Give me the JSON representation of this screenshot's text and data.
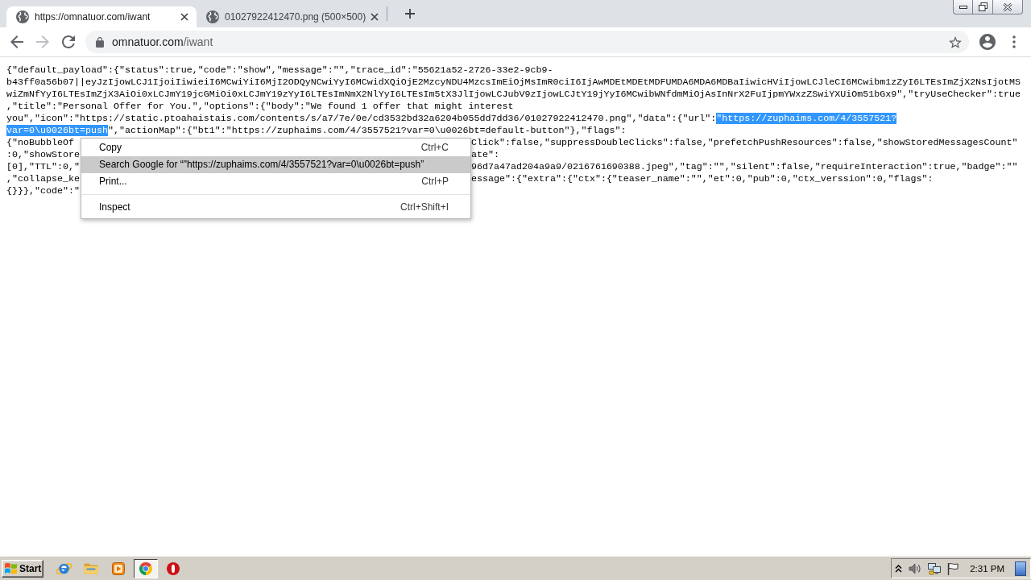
{
  "tabs": [
    {
      "title": "https://omnatuor.com/iwant",
      "selected": true
    },
    {
      "title": "01027922412470.png (500×500)",
      "selected": false
    }
  ],
  "toolbar": {
    "nav_buttons": [
      {
        "kind": "back",
        "disabled": false
      },
      {
        "kind": "forward",
        "disabled": true
      },
      {
        "kind": "reload",
        "disabled": false
      }
    ],
    "address": {
      "host": "omnatuor.com",
      "path": "/iwant"
    }
  },
  "page": {
    "lines": [
      {
        "kind": "text",
        "segments": [
          {
            "text": "{\"default_payload\":{\"status\":true,\"code\":\"show\",\"message\":\"\",\"trace_id\":\"55621a52-2726-33e2-9cb9-",
            "selected": false
          }
        ]
      },
      {
        "kind": "text",
        "segments": [
          {
            "text": "b43ff0a56b07||eyJzIjowLCJ1IjoiIiwieiI6MCwiYiI6MjI2ODQyNCwiYyI6MCwidXQiOjE2MzcyNDU4MzcsImEiOjMsImR0ciI6IjAwMDEtMDEtMDFUMDA6MDA6MDBaIiwicHViIjowLCJleCI6MCwibm1zZyI6LTEsImZjX2NsIjotMS",
            "selected": false
          }
        ]
      },
      {
        "kind": "text",
        "segments": [
          {
            "text": "wiZmNfYyI6LTEsImZjX3AiOi0xLCJmY19jcGMiOi0xLCJmY19zYyI6LTEsImNmX2NlYyI6LTEsIm5tX3JlIjowLCJubV9zIjowLCJtY19jYyI6MCwibWNfdmMiOjAsInNrX2FuIjpmYWxzZSwiYXUiOm51bGx9\",\"tryUseChecker\":true",
            "selected": false
          }
        ]
      },
      {
        "kind": "text",
        "segments": [
          {
            "text": ",\"title\":\"Personal Offer for You.\",\"options\":{\"body\":\"We found 1 offer that might interest",
            "selected": false
          }
        ]
      },
      {
        "kind": "text",
        "segments": [
          {
            "text": "you\",\"icon\":\"https://static.ptoahaistais.com/contents/s/a7/7e/0e/cd3532bd32a6204b055dd7dd36/01027922412470.png\",\"data\":{\"url\":",
            "selected": false
          },
          {
            "text": "\"https://zuphaims.com/4/3557521?",
            "selected": true
          }
        ]
      },
      {
        "kind": "text",
        "segments": [
          {
            "text": "var=0\\u0026bt=push",
            "selected": true
          },
          {
            "text": "\",\"actionMap\":{\"bt1\":\"https://zuphaims.com/4/3557521?var=0\\u0026bt=default-button\"},\"flags\":",
            "selected": false
          }
        ]
      },
      {
        "kind": "split",
        "left": "{\"noBubbleOf",
        "right": "Click\":false,\"suppressDoubleClicks\":false,\"prefetchPushResources\":false,\"showStoredMessagesCount\""
      },
      {
        "kind": "split",
        "left": ":0,\"showStore",
        "right": "ate\":"
      },
      {
        "kind": "split",
        "left": "[0],\"TTL\":0,\"",
        "right": "96d7a47ad204a9a9/0216761690388.jpeg\",\"tag\":\"\",\"silent\":false,\"requireInteraction\":true,\"badge\":\"\""
      },
      {
        "kind": "split",
        "left": ",\"collapse_ke",
        "right": "essage\":{\"extra\":{\"ctx\":{\"teaser_name\":\"\",\"et\":0,\"pub\":0,\"ctx_verssion\":0,\"flags\":"
      },
      {
        "kind": "split",
        "left": "{}}},\"code\":\""
      }
    ]
  },
  "context_menu": {
    "items": [
      {
        "kind": "item",
        "label": "Copy",
        "shortcut": "Ctrl+C",
        "selected": false
      },
      {
        "kind": "item",
        "label": "Search Google for “\"https://zuphaims.com/4/3557521?var=0\\u0026bt=push”",
        "selected": true
      },
      {
        "kind": "item",
        "label": "Print...",
        "shortcut": "Ctrl+P",
        "selected": false
      },
      {
        "kind": "separator"
      },
      {
        "kind": "item",
        "label": "Inspect",
        "shortcut": "Ctrl+Shift+I",
        "selected": false
      }
    ]
  },
  "taskbar": {
    "start_label": "Start",
    "apps": [
      {
        "kind": "e_logo",
        "selected": false
      },
      {
        "kind": "folder",
        "selected": false
      },
      {
        "kind": "player",
        "selected": false
      },
      {
        "kind": "round_logo",
        "selected": true
      },
      {
        "kind": "ring_logo",
        "selected": false
      }
    ],
    "clock": "2:31 PM"
  }
}
